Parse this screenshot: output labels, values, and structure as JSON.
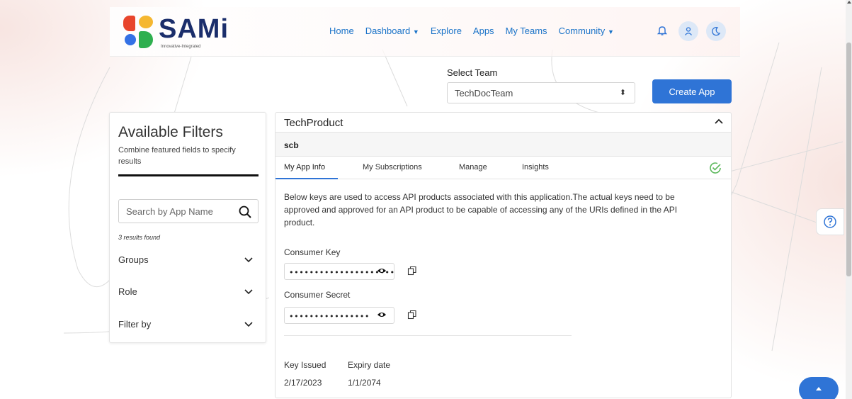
{
  "brand": {
    "name": "SAMi",
    "tagline": "Innovative-Integrated"
  },
  "nav": {
    "items": [
      {
        "label": "Home"
      },
      {
        "label": "Dashboard",
        "dropdown": true
      },
      {
        "label": "Explore"
      },
      {
        "label": "Apps"
      },
      {
        "label": "My Teams"
      },
      {
        "label": "Community",
        "dropdown": true
      }
    ],
    "icons": [
      "bell-icon",
      "user-icon",
      "moon-icon"
    ]
  },
  "team": {
    "label": "Select Team",
    "selected": "TechDocTeam"
  },
  "create_app_label": "Create App",
  "filters": {
    "title": "Available Filters",
    "subtitle": "Combine featured fields to specify results",
    "search_placeholder": "Search by App Name",
    "results_text": "3 results found",
    "groups": [
      "Groups",
      "Role",
      "Filter by"
    ]
  },
  "product": {
    "name": "TechProduct",
    "app_name": "scb",
    "tabs": [
      "My App Info",
      "My Subscriptions",
      "Manage",
      "Insights"
    ],
    "active_tab": "My App Info",
    "description": "Below keys are used to access API products associated with this application.The actual keys need to be approved and approved for an API product to be capable of accessing any of the URIs defined in the API product.",
    "consumer_key_label": "Consumer Key",
    "consumer_key_masked": "••••••••••••••••••••••••••",
    "consumer_secret_label": "Consumer Secret",
    "consumer_secret_masked": "••••••••••••••••",
    "key_issued_label": "Key Issued",
    "key_issued_value": "2/17/2023",
    "expiry_label": "Expiry date",
    "expiry_value": "1/1/2074"
  },
  "colors": {
    "accent": "#2f74d6",
    "brand_navy": "#1b2e6b",
    "check_green": "#5cb85c"
  }
}
